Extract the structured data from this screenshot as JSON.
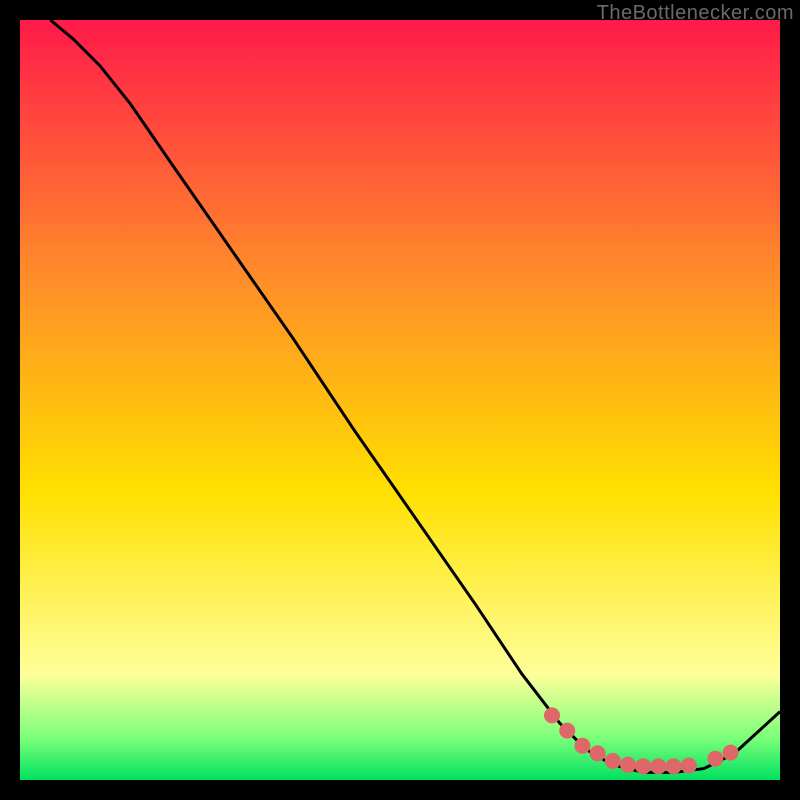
{
  "watermark": "TheBottlenecker.com",
  "colors": {
    "black": "#000000",
    "curve_stroke": "#000000",
    "dot_fill": "#de6868",
    "grad_top": "#ff1a4a",
    "grad_mid1": "#ff8a2a",
    "grad_mid2": "#ffe000",
    "grad_pale": "#ffff9a",
    "grad_green1": "#7aff7a",
    "grad_green2": "#00e060"
  },
  "chart_data": {
    "type": "line",
    "title": "",
    "xlabel": "",
    "ylabel": "",
    "xlim": [
      0,
      100
    ],
    "ylim": [
      0,
      100
    ],
    "series": [
      {
        "name": "curve",
        "x": [
          4,
          7,
          10.5,
          14.5,
          20,
          28,
          36,
          44,
          52,
          60,
          66,
          71,
          74.5,
          78,
          82,
          86,
          90,
          94,
          100
        ],
        "y": [
          100,
          97.5,
          94,
          89,
          81,
          69.5,
          58,
          46,
          34.5,
          23,
          14,
          7.5,
          4,
          2,
          1,
          1,
          1.5,
          3.5,
          9
        ]
      }
    ],
    "dots": {
      "name": "dots",
      "x": [
        70,
        72,
        74,
        76,
        78,
        80,
        82,
        84,
        86,
        88,
        91.5,
        93.5
      ],
      "y": [
        8.5,
        6.5,
        4.5,
        3.5,
        2.5,
        2,
        1.8,
        1.8,
        1.8,
        1.9,
        2.8,
        3.6
      ]
    }
  }
}
